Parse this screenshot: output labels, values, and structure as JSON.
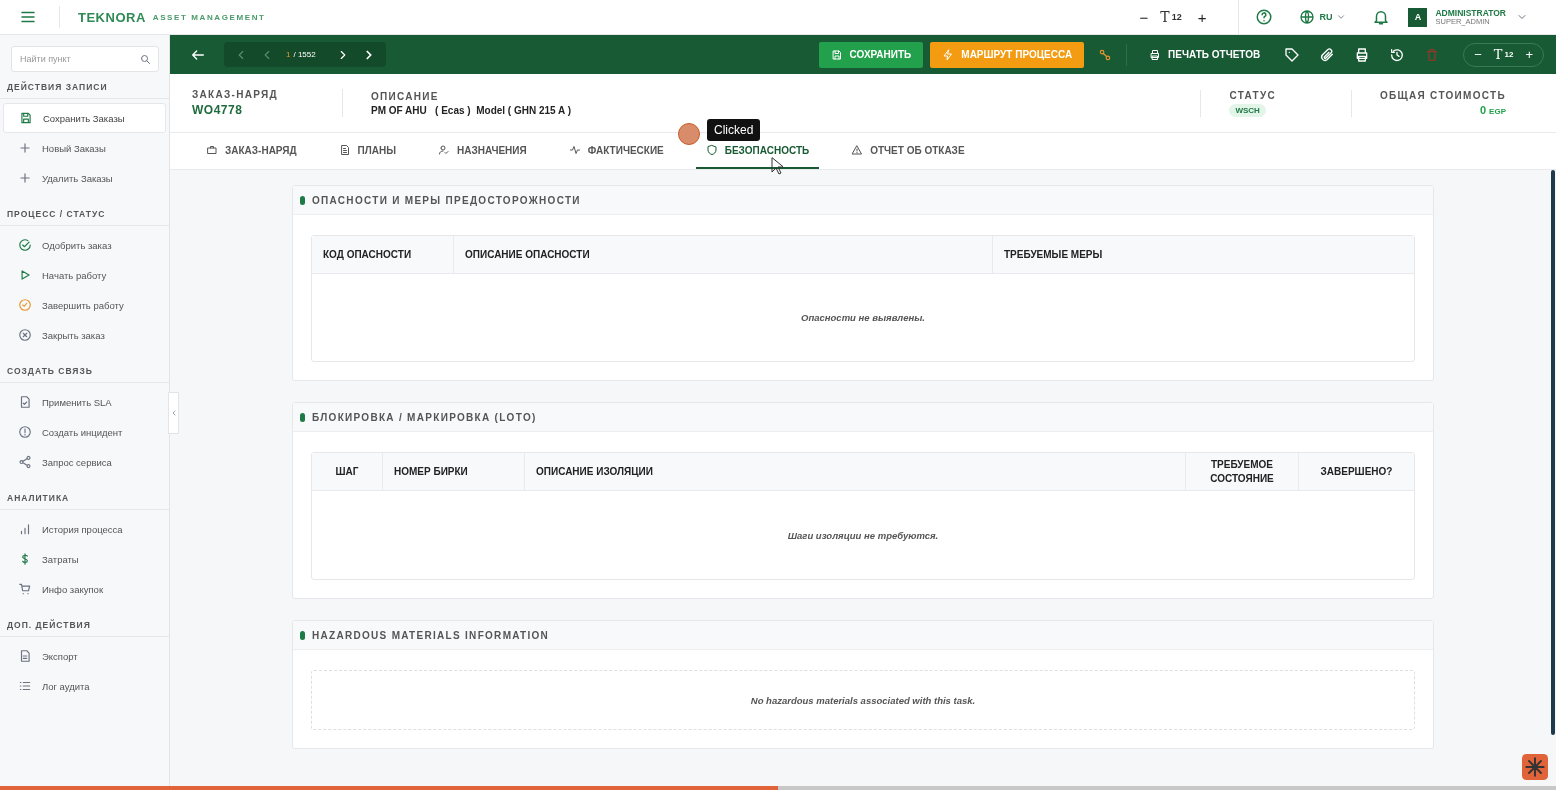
{
  "topbar": {
    "brand": "TEKNORA",
    "brand_sub": "ASSET MANAGEMENT",
    "font_size": {
      "minus": "−",
      "icon": "T",
      "value": "12",
      "plus": "+"
    },
    "language": "RU",
    "user": {
      "initial": "A",
      "name": "ADMINISTRATOR",
      "role": "SUPER_ADMIN"
    }
  },
  "sidebar": {
    "search": {
      "placeholder": "Найти пункт"
    },
    "sections": [
      {
        "title": "ДЕЙСТВИЯ ЗАПИСИ",
        "items": [
          {
            "label": "Сохранить Заказы",
            "selected": true
          },
          {
            "label": "Новый Заказы",
            "selected": false
          },
          {
            "label": "Удалить Заказы",
            "selected": false
          }
        ]
      },
      {
        "title": "ПРОЦЕСС / СТАТУС",
        "items": [
          {
            "label": "Одобрить заказ",
            "selected": false
          },
          {
            "label": "Начать работу",
            "selected": false
          },
          {
            "label": "Завершить работу",
            "selected": false
          },
          {
            "label": "Закрыть заказ",
            "selected": false
          }
        ]
      },
      {
        "title": "СОЗДАТЬ СВЯЗЬ",
        "items": [
          {
            "label": "Применить SLA",
            "selected": false
          },
          {
            "label": "Создать инцидент",
            "selected": false
          },
          {
            "label": "Запрос сервиса",
            "selected": false
          }
        ]
      },
      {
        "title": "АНАЛИТИКА",
        "items": [
          {
            "label": "История процесса",
            "selected": false
          },
          {
            "label": "Затраты",
            "selected": false
          },
          {
            "label": "Инфо закупок",
            "selected": false
          }
        ]
      },
      {
        "title": "ДОП. ДЕЙСТВИЯ",
        "items": [
          {
            "label": "Экспорт",
            "selected": false
          },
          {
            "label": "Лог аудита",
            "selected": false
          }
        ]
      }
    ]
  },
  "toolbar": {
    "pager": {
      "current": "1",
      "total": "/ 1552"
    },
    "buttons": [
      {
        "kind": "save",
        "label": "СОХРАНИТЬ"
      },
      {
        "kind": "route",
        "label": "МАРШРУТ ПРОЦЕССА"
      }
    ],
    "print_label": "ПЕЧАТЬ ОТЧЕТОВ",
    "font_size": {
      "minus": "−",
      "icon": "T",
      "value": "12",
      "plus": "+"
    }
  },
  "record": {
    "fields": [
      {
        "label": "ЗАКАЗ-НАРЯД",
        "value": "WO4778"
      },
      {
        "label": "ОПИСАНИЕ",
        "value": "PM OF AHU   ( Ecas )  Model ( GHN 215 A )"
      }
    ],
    "status": {
      "label": "СТАТУС",
      "value": "WSCH"
    },
    "cost": {
      "label": "ОБЩАЯ СТОИМОСТЬ",
      "value": "0",
      "currency": "EGP"
    }
  },
  "tabs": [
    {
      "label": "ЗАКАЗ-НАРЯД",
      "selected": false
    },
    {
      "label": "ПЛАНЫ",
      "selected": false
    },
    {
      "label": "НАЗНАЧЕНИЯ",
      "selected": false
    },
    {
      "label": "ФАКТИЧЕСКИЕ",
      "selected": false
    },
    {
      "label": "БЕЗОПАСНОСТЬ",
      "selected": true
    },
    {
      "label": "ОТЧЕТ ОБ ОТКАЗЕ",
      "selected": false
    }
  ],
  "sections": [
    {
      "title": "ОПАСНОСТИ И МЕРЫ ПРЕДОСТОРОЖНОСТИ",
      "kind": "table",
      "columns": [
        "КОД ОПАСНОСТИ",
        "ОПИСАНИЕ ОПАСНОСТИ",
        "ТРЕБУЕМЫЕ МЕРЫ"
      ],
      "empty": "Опасности не выявлены."
    },
    {
      "title": "БЛОКИРОВКА / МАРКИРОВКА (LOTO)",
      "kind": "table",
      "columns": [
        "ШАГ",
        "НОМЕР БИРКИ",
        "ОПИСАНИЕ ИЗОЛЯЦИИ",
        "ТРЕБУЕМОЕ СОСТОЯНИЕ",
        "ЗАВЕРШЕНО?"
      ],
      "empty": "Шаги изоляции не требуются."
    },
    {
      "title": "HAZARDOUS MATERIALS INFORMATION",
      "kind": "empty",
      "empty": "No hazardous materials associated with this task."
    }
  ],
  "overlay": {
    "tooltip": "Clicked"
  },
  "playback": {
    "level": 0.5
  }
}
